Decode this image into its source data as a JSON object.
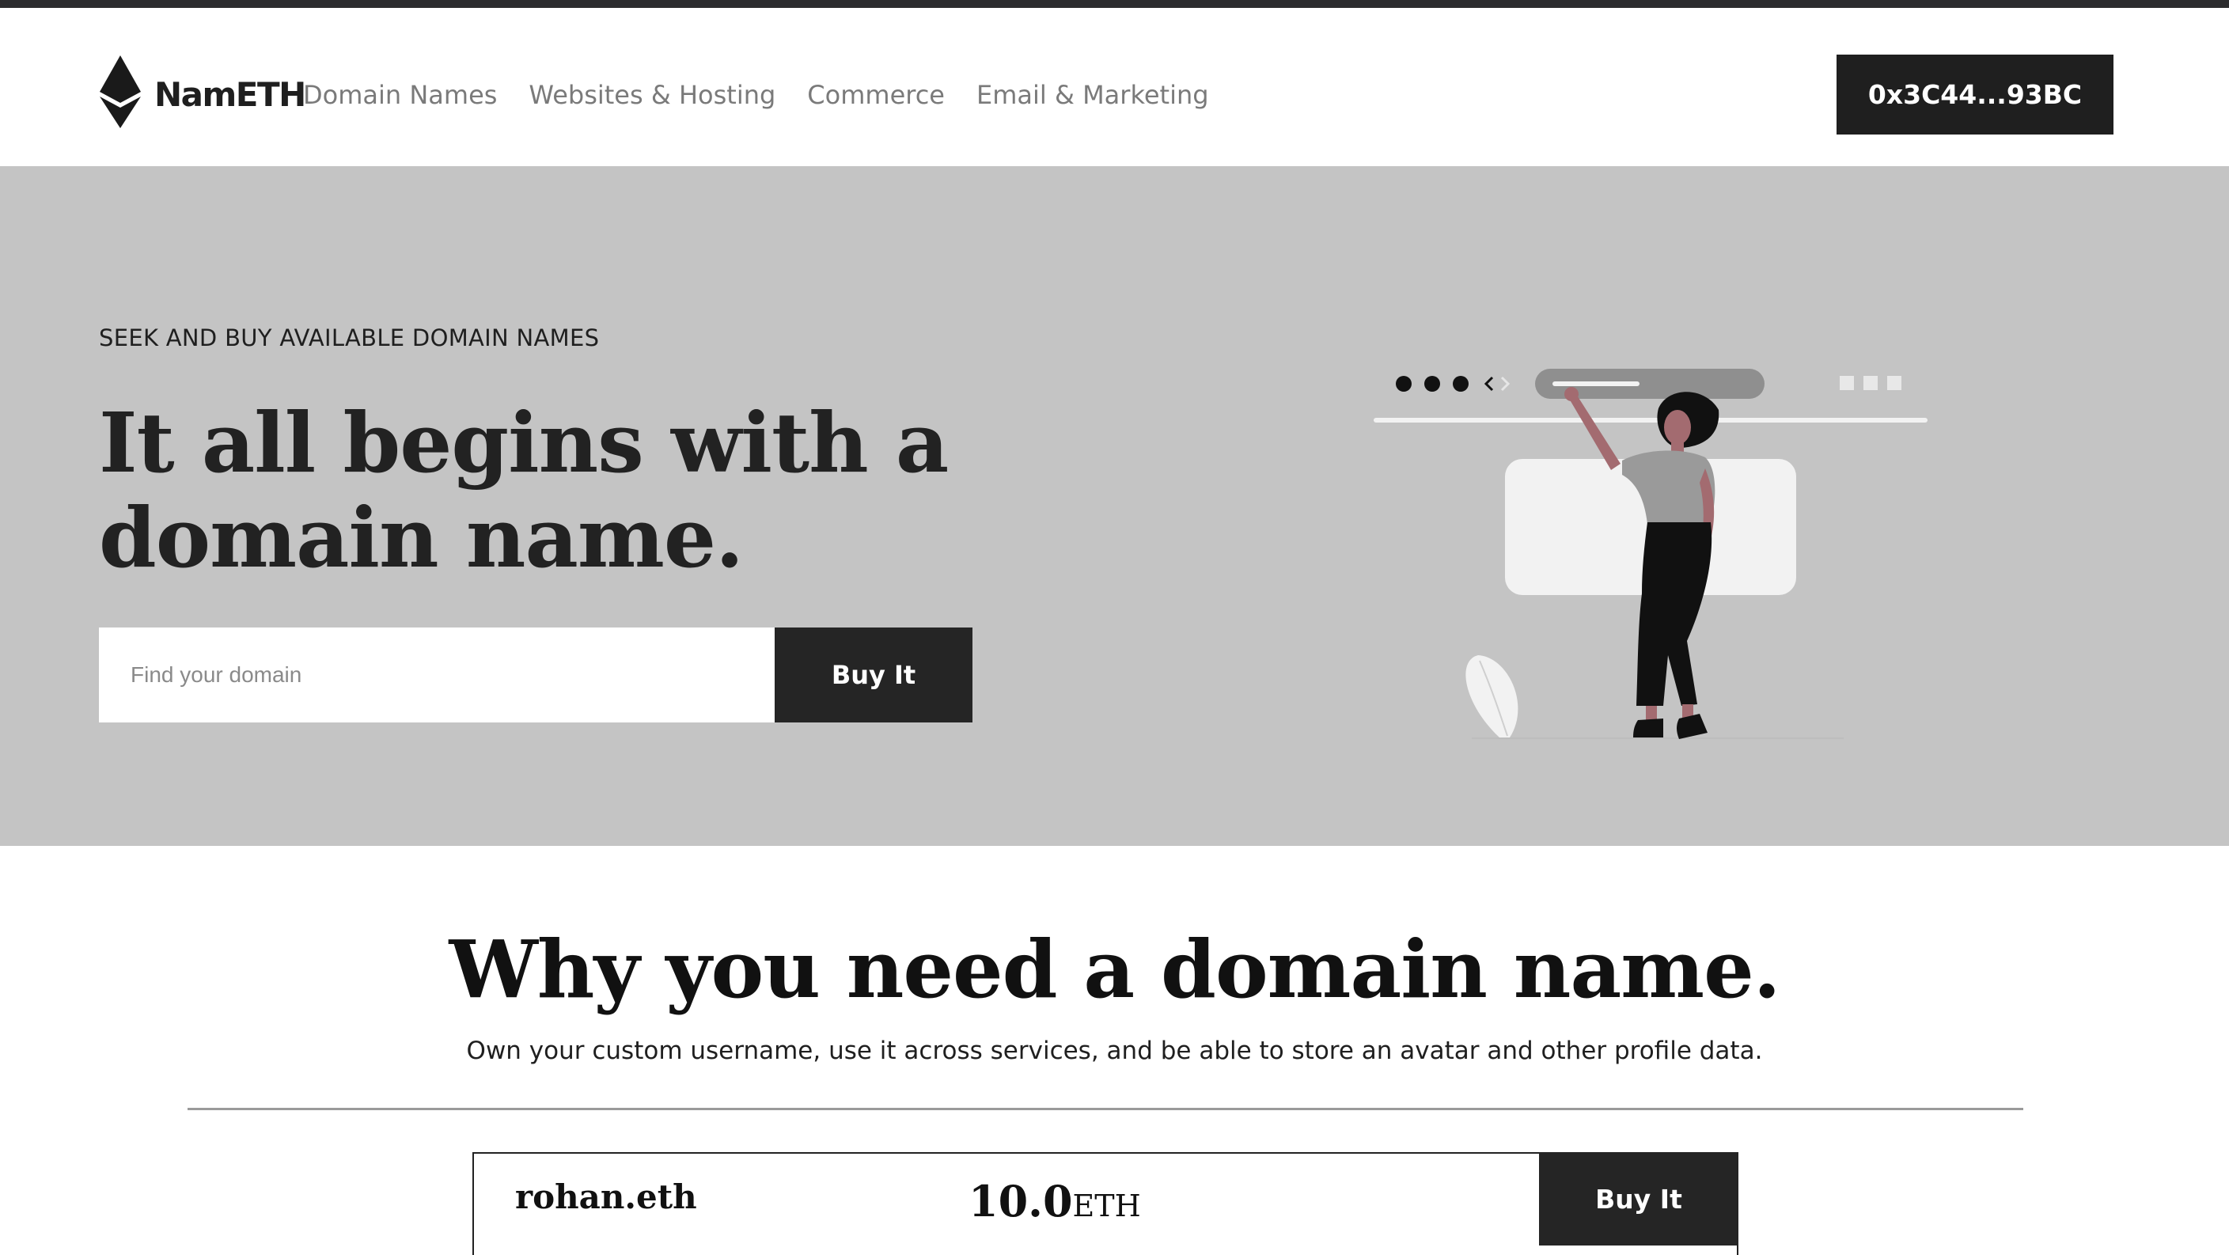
{
  "header": {
    "brand": "NamETH",
    "logo_icon": "ethereum-diamond-icon",
    "nav": [
      "Domain Names",
      "Websites & Hosting",
      "Commerce",
      "Email & Marketing"
    ],
    "wallet_label": "0x3C44...93BC"
  },
  "hero": {
    "eyebrow": "SEEK AND BUY AVAILABLE DOMAIN NAMES",
    "title": "It all begins with a domain name.",
    "search_placeholder": "Find your domain",
    "search_value": "",
    "buy_label": "Buy It",
    "illustration": "woman-browsing-browser-window-illustration"
  },
  "why": {
    "title": "Why you need a domain name.",
    "subtitle": "Own your custom username, use it across services, and be able to store an avatar and other profile data."
  },
  "listing": {
    "name": "rohan.eth",
    "price": "10.0",
    "unit": "ETH",
    "buy_label": "Buy It"
  },
  "colors": {
    "top_bar": "#2c2c2e",
    "hero_bg": "#c4c4c4",
    "dark_button": "#1f1f1f",
    "nav_text": "#7a7a7a"
  }
}
